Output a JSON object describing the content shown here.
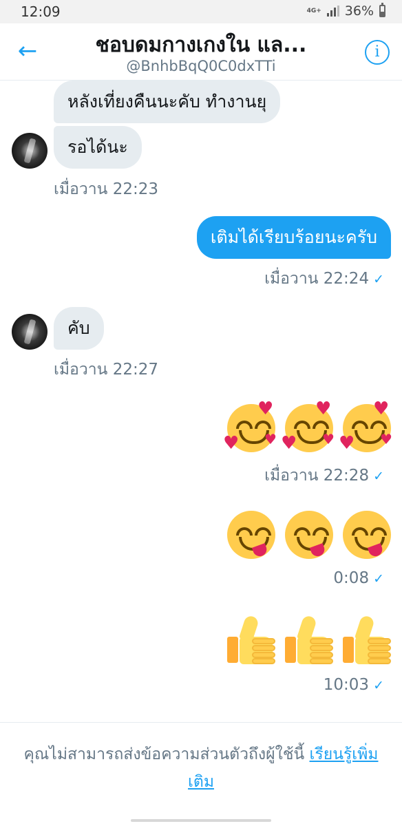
{
  "status_bar": {
    "time": "12:09",
    "network": "4G+",
    "battery": "36%"
  },
  "header": {
    "title": "ชอบดมกางเกงใน แล...",
    "handle": "@BnhbBqQ0C0dxTTi",
    "back_icon": "arrow-left-icon",
    "info_icon": "info-icon"
  },
  "messages": [
    {
      "direction": "incoming",
      "text": "หลังเที่ยงคืนนะคับ ทำงานยุ"
    },
    {
      "direction": "incoming",
      "text": "รอได้นะ",
      "time": "เมื่อวาน 22:23"
    },
    {
      "direction": "outgoing",
      "text": "เติมได้เรียบร้อยนะครับ",
      "time": "เมื่อวาน 22:24",
      "read": true
    },
    {
      "direction": "incoming",
      "text": "คับ",
      "time": "เมื่อวาน 22:27"
    },
    {
      "direction": "outgoing",
      "emoji": [
        "smiling-face-with-hearts",
        "smiling-face-with-hearts",
        "smiling-face-with-hearts"
      ],
      "time": "เมื่อวาน 22:28",
      "read": true
    },
    {
      "direction": "outgoing",
      "emoji": [
        "face-savoring-food",
        "face-savoring-food",
        "face-savoring-food"
      ],
      "time": "0:08",
      "read": true
    },
    {
      "direction": "outgoing",
      "emoji": [
        "thumbs-up",
        "thumbs-up",
        "thumbs-up"
      ],
      "time": "10:03",
      "read": true
    }
  ],
  "footer": {
    "notice": "คุณไม่สามารถส่งข้อความส่วนตัวถึงผู้ใช้นี้",
    "learn_more": "เรียนรู้เพิ่มเติม"
  },
  "colors": {
    "accent": "#1da1f2",
    "incoming_bubble": "#e6ecf0",
    "muted_text": "#657786"
  }
}
